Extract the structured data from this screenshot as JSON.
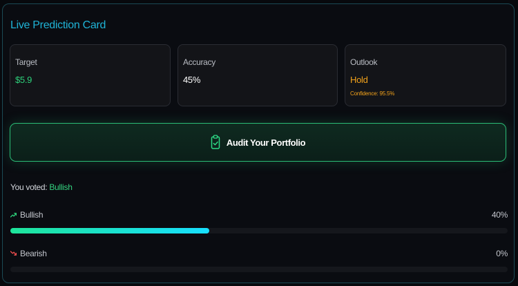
{
  "card": {
    "title": "Live Prediction Card",
    "stats": [
      {
        "label": "Target",
        "value": "$5.9",
        "color": "#2dd07a"
      },
      {
        "label": "Accuracy",
        "value": "45%",
        "color": "#ffffff"
      },
      {
        "label": "Outlook",
        "value": "Hold",
        "color": "#f2a21b",
        "sub": "Confidence: 95.5%"
      }
    ],
    "audit_button": {
      "label": "Audit Your Portfolio",
      "icon": "clipboard-check-icon"
    },
    "vote": {
      "prefix": "You voted:",
      "choice": "Bullish"
    },
    "options": [
      {
        "label": "Bullish",
        "percent": "40%",
        "fill": 0.4,
        "icon": "trending-up-icon",
        "icon_color": "#2dd07a"
      },
      {
        "label": "Bearish",
        "percent": "0%",
        "fill": 0.0,
        "icon": "trending-down-icon",
        "icon_color": "#ef4d4d"
      }
    ]
  }
}
